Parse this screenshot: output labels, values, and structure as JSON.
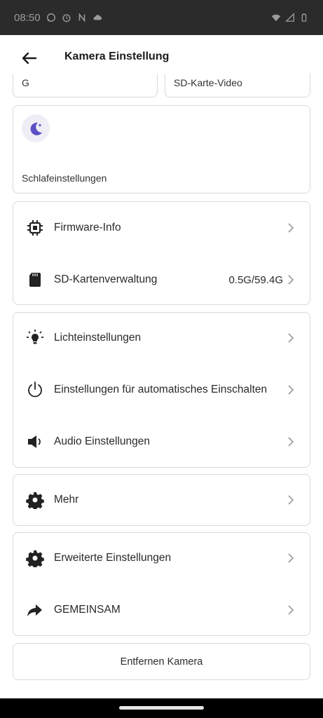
{
  "status_bar": {
    "time": "08:50",
    "icons_left": [
      "whatsapp-icon",
      "alarm-icon",
      "n-icon",
      "cloud-icon"
    ],
    "icons_right": [
      "wifi-icon",
      "signal-icon",
      "battery-icon"
    ]
  },
  "header": {
    "title": "Kamera Einstellung"
  },
  "top_tiles": {
    "left_partial": "G",
    "right_partial": "SD-Karte-Video"
  },
  "sleep_card": {
    "label": "Schlafeinstellungen",
    "accent": "#5b4fc4"
  },
  "group1": [
    {
      "label": "Firmware-Info",
      "value": "",
      "icon": "chip-icon"
    },
    {
      "label": "SD-Kartenverwaltung",
      "value": "0.5G/59.4G",
      "icon": "sd-card-icon"
    }
  ],
  "group2": [
    {
      "label": "Lichteinstellungen",
      "icon": "lightbulb-icon"
    },
    {
      "label": "Einstellungen für automatisches Einschalten",
      "icon": "power-icon"
    },
    {
      "label": "Audio Einstellungen",
      "icon": "speaker-icon"
    }
  ],
  "group3": [
    {
      "label": "Mehr",
      "icon": "gear-icon"
    }
  ],
  "group4": [
    {
      "label": "Erweiterte Einstellungen",
      "icon": "gear-icon"
    },
    {
      "label": "GEMEINSAM",
      "icon": "share-icon"
    }
  ],
  "remove_button": "Entfernen Kamera"
}
